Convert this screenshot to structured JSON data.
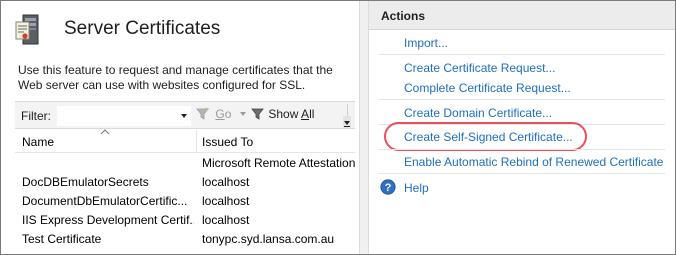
{
  "page": {
    "title": "Server Certificates",
    "icon": "server-certificates-icon",
    "description": "Use this feature to request and manage certificates that the Web server can use with websites configured for SSL."
  },
  "filter": {
    "label": "Filter:",
    "value": "",
    "go_label": "Go",
    "show_all_label": "Show All"
  },
  "columns": {
    "name": "Name",
    "issued_to": "Issued To"
  },
  "rows": [
    {
      "name": "",
      "issued_to": "Microsoft Remote Attestation"
    },
    {
      "name": "DocDBEmulatorSecrets",
      "issued_to": "localhost"
    },
    {
      "name": "DocumentDbEmulatorCertific...",
      "issued_to": "localhost"
    },
    {
      "name": "IIS Express Development Certif...",
      "issued_to": "localhost"
    },
    {
      "name": "Test Certificate",
      "issued_to": "tonypc.syd.lansa.com.au"
    }
  ],
  "actions": {
    "header": "Actions",
    "items": [
      {
        "label": "Import..."
      },
      {
        "label": "Create Certificate Request..."
      },
      {
        "label": "Complete Certificate Request..."
      },
      {
        "label": "Create Domain Certificate..."
      },
      {
        "label": "Create Self-Signed Certificate...",
        "highlighted": true
      },
      {
        "label": "Enable Automatic Rebind of Renewed Certificate"
      }
    ],
    "help_label": "Help"
  },
  "colors": {
    "link": "#1d6fc0",
    "highlight_ring": "#e8505b",
    "actions_header_bg": "#ececec"
  }
}
